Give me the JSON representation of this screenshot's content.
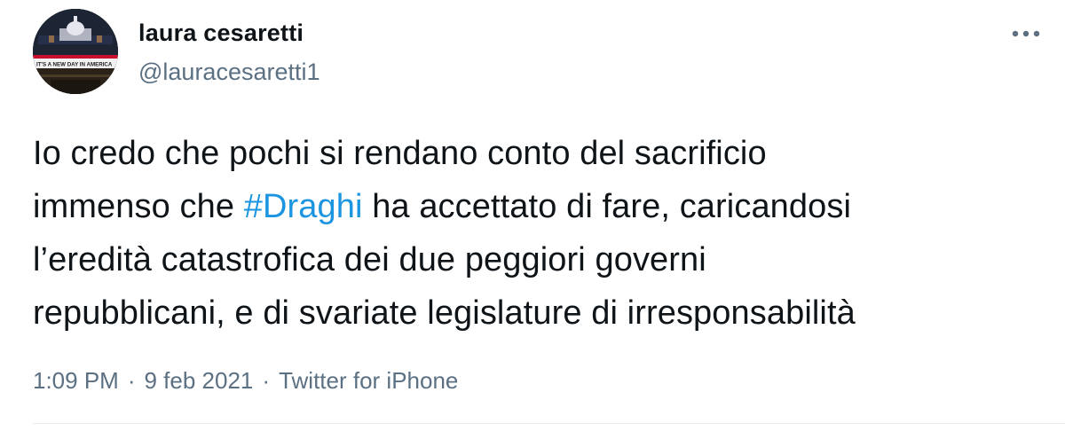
{
  "author": {
    "display_name": "laura cesaretti",
    "handle": "@lauracesaretti1",
    "avatar_caption": "IT'S A NEW DAY IN AMERICA"
  },
  "more_icon": "more-dots-icon",
  "tweet": {
    "line1": "Io credo che pochi si rendano conto del sacrificio",
    "line2_before": "immenso che ",
    "line2_hashtag": "#Draghi",
    "line2_after": " ha accettato di fare, caricandosi",
    "line3": "l’eredità catastrofica dei due peggiori governi",
    "line4": "repubblicani, e di svariate legislature di irresponsabilità"
  },
  "meta": {
    "time": "1:09 PM",
    "separator": "·",
    "date": "9 feb 2021",
    "source": "Twitter for iPhone"
  },
  "colors": {
    "text": "#0f1419",
    "secondary": "#5b7083",
    "link": "#1b95e0",
    "divider": "#e6ecf0"
  }
}
